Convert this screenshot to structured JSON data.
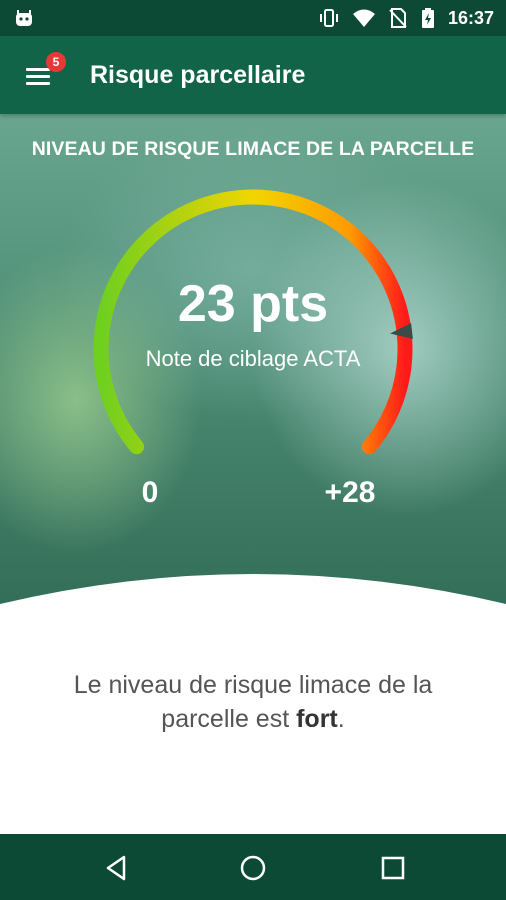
{
  "status_bar": {
    "time": "16:37",
    "icons": [
      "robot-icon",
      "vibrate-icon",
      "wifi-icon",
      "no-sim-icon",
      "battery-charging-icon"
    ]
  },
  "app_bar": {
    "title": "Risque parcellaire",
    "notification_count": "5",
    "menu_icon": "hamburger-menu-icon"
  },
  "hero": {
    "title": "NIVEAU DE RISQUE LIMACE DE LA PARCELLE",
    "score": "23 pts",
    "score_caption": "Note de ciblage ACTA",
    "min_label": "0",
    "max_label": "+28",
    "gauge_value": 23,
    "gauge_min": 0,
    "gauge_max": 28,
    "colors": {
      "low": "#6fcf1f",
      "mid": "#f2d500",
      "high": "#ff1a1a"
    }
  },
  "message": {
    "before": "Le niveau de risque limace de la parcelle est ",
    "emphasis": "fort",
    "after": "."
  },
  "nav_bar": {
    "back": "back-icon",
    "home": "home-icon",
    "recents": "recents-icon"
  }
}
